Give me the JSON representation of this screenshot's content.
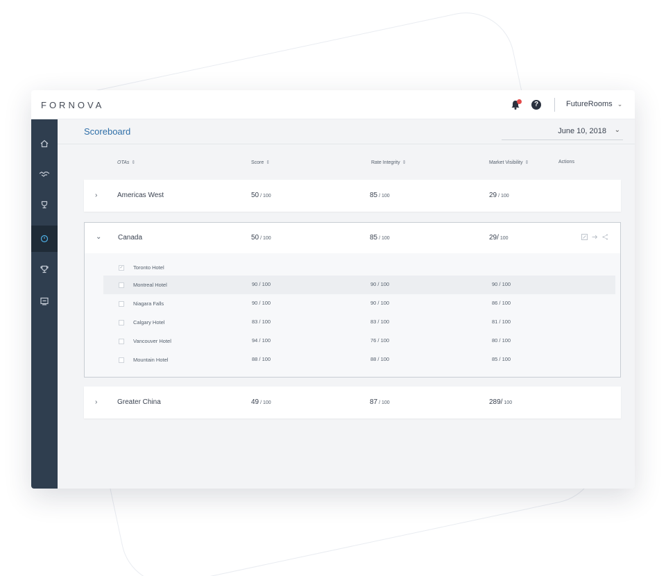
{
  "brand": "FORNOVA",
  "account": "FutureRooms",
  "page_title": "Scoreboard",
  "date_filter": "June 10, 2018",
  "columns": {
    "otas": "OTAs",
    "score": "Score",
    "rate_integrity": "Rate Integrity",
    "market_visibility": "Market Visibility",
    "actions": "Actions"
  },
  "sidebar": [
    "home-icon",
    "handshake-icon",
    "trophy-outline-icon",
    "dashboard-icon",
    "trophy-icon",
    "report-icon"
  ],
  "colors": {
    "accent": "#2f6fa8",
    "sidebar": "#2f3e4f",
    "sidebar_active": "#1f2b37",
    "notification": "#e34b4b"
  },
  "regions": [
    {
      "name": "Americas West",
      "expanded": false,
      "score": {
        "value": "50",
        "denom": " / 100"
      },
      "rate": {
        "value": "85",
        "denom": " / 100"
      },
      "market": {
        "value": "29",
        "denom": " / 100"
      }
    },
    {
      "name": "Canada",
      "expanded": true,
      "score": {
        "value": "50",
        "denom": " / 100"
      },
      "rate": {
        "value": "85",
        "denom": " / 100"
      },
      "market": {
        "value": "29/",
        "denom": " 100"
      },
      "hotels": [
        {
          "name": "Toronto Hotel",
          "checked": true,
          "score": "",
          "rate": "",
          "market": ""
        },
        {
          "name": "Montreal Hotel",
          "checked": false,
          "score": "90 / 100",
          "rate": "90 / 100",
          "market": "90 / 100"
        },
        {
          "name": "Niagara Falls",
          "checked": false,
          "score": "90 / 100",
          "rate": "90 / 100",
          "market": "86 / 100"
        },
        {
          "name": "Calgary Hotel",
          "checked": false,
          "score": "83 / 100",
          "rate": "83 / 100",
          "market": "81 / 100"
        },
        {
          "name": "Vancouver Hotel",
          "checked": false,
          "score": "94 / 100",
          "rate": "76 / 100",
          "market": "80 / 100"
        },
        {
          "name": "Mountain Hotel",
          "checked": false,
          "score": "88 / 100",
          "rate": "88 / 100",
          "market": "85 / 100"
        }
      ]
    },
    {
      "name": "Greater China",
      "expanded": false,
      "score": {
        "value": "49",
        "denom": " / 100"
      },
      "rate": {
        "value": "87",
        "denom": " / 100"
      },
      "market": {
        "value": "289/",
        "denom": " 100"
      }
    }
  ]
}
